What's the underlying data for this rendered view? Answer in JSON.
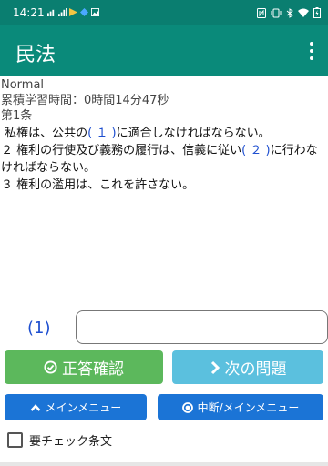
{
  "status_bar": {
    "time": "14:21",
    "left_icons": [
      "sim-signal-icon",
      "signal-icon",
      "app-notification-icon",
      "app-notification-icon",
      "image-icon"
    ],
    "right_icons": [
      "nfc-icon",
      "vibrate-icon",
      "bluetooth-icon",
      "wifi-icon",
      "battery-charging-icon"
    ]
  },
  "app_bar": {
    "title": "民法",
    "menu_icon": "overflow-menu-icon",
    "background": "#0a8a7a"
  },
  "content": {
    "mode": "Normal",
    "study_time": "累積学習時間：0時間14分47秒",
    "article_title": "第1条",
    "paragraphs": [
      {
        "before": "私権は、公共の",
        "blank": "( １ )",
        "after": "に適合しなければならない。"
      },
      {
        "before": "２ 権利の行使及び義務の履行は、信義に従い",
        "blank": "( ２ )",
        "after": "に行わなければならない。"
      },
      {
        "before": "３ 権利の濫用は、これを許さない。",
        "blank": "",
        "after": ""
      }
    ]
  },
  "answer": {
    "label": "(1)",
    "value": "",
    "placeholder": ""
  },
  "buttons": {
    "check": {
      "label": "正答確認",
      "icon": "check-circle-icon",
      "color": "#5cb85c"
    },
    "next": {
      "label": "次の問題",
      "icon": "chevron-right-icon",
      "color": "#5bc0de"
    },
    "main_menu": {
      "label": "メインメニュー",
      "icon": "chevron-up-icon",
      "color": "#1b74d6"
    },
    "suspend_menu": {
      "label": "中断/メインメニュー",
      "icon": "record-icon",
      "color": "#1b74d6"
    }
  },
  "checkbox": {
    "label": "要チェック条文",
    "checked": false
  }
}
